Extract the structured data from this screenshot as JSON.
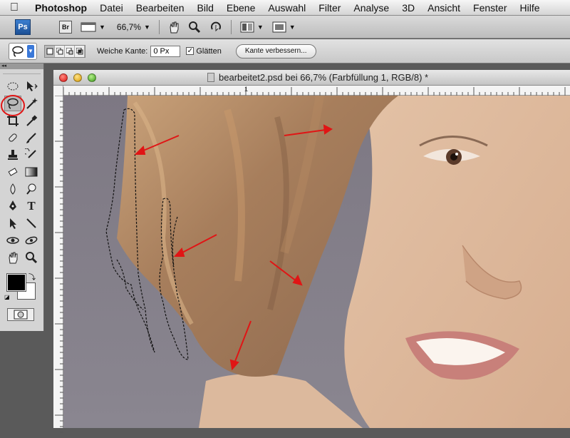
{
  "menubar": {
    "app": "Photoshop",
    "items": [
      "Datei",
      "Bearbeiten",
      "Bild",
      "Ebene",
      "Auswahl",
      "Filter",
      "Analyse",
      "3D",
      "Ansicht",
      "Fenster",
      "Hilfe"
    ]
  },
  "app_toolbar": {
    "ps_logo": "Ps",
    "br_logo": "Br",
    "zoom": "66,7%"
  },
  "options": {
    "feather_label": "Weiche Kante:",
    "feather_value": "0 Px",
    "antialias_label": "Glätten",
    "antialias_checked": true,
    "refine_button": "Kante verbessern..."
  },
  "tools": {
    "header": "◂◂",
    "foreground_color": "#000000",
    "background_color": "#ffffff"
  },
  "document": {
    "title": "bearbeitet2.psd bei 66,7% (Farbfüllung 1, RGB/8) *",
    "ruler_top_label": "1"
  },
  "colors": {
    "annotation_red": "#e01515",
    "canvas_bg": "#7a7580"
  }
}
